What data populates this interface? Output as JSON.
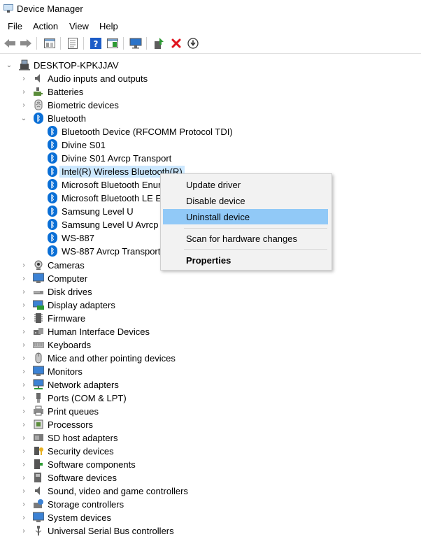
{
  "window": {
    "title": "Device Manager"
  },
  "menu": {
    "file": "File",
    "action": "Action",
    "view": "View",
    "help": "Help"
  },
  "toolbar": {
    "icons": [
      "back-arrow-icon",
      "forward-arrow-icon",
      "properties-grid-icon",
      "sheet-icon",
      "help-icon",
      "panel-icon",
      "monitor-icon",
      "update-driver-icon",
      "uninstall-x-icon",
      "download-circle-icon"
    ],
    "colors": {
      "help": "#1c5cc7",
      "uninstall": "#e0141e",
      "update": "#2e9a34"
    }
  },
  "tree": {
    "root": "DESKTOP-KPKJJAV",
    "categories_before": [
      {
        "label": "Audio inputs and outputs",
        "icon": "speaker-icon"
      },
      {
        "label": "Batteries",
        "icon": "battery-icon"
      },
      {
        "label": "Biometric devices",
        "icon": "fingerprint-icon"
      }
    ],
    "bluetooth": {
      "label": "Bluetooth",
      "children": [
        "Bluetooth Device (RFCOMM Protocol TDI)",
        "Divine S01",
        "Divine S01 Avrcp Transport",
        "Intel(R) Wireless Bluetooth(R)",
        "Microsoft Bluetooth Enum",
        "Microsoft Bluetooth LE En",
        "Samsung Level U",
        "Samsung Level U Avrcp Tr",
        "WS-887",
        "WS-887 Avrcp Transport"
      ],
      "selected_index": 3
    },
    "categories_after": [
      {
        "label": "Cameras",
        "icon": "camera-icon"
      },
      {
        "label": "Computer",
        "icon": "computer-icon"
      },
      {
        "label": "Disk drives",
        "icon": "disk-drive-icon"
      },
      {
        "label": "Display adapters",
        "icon": "display-adapter-icon"
      },
      {
        "label": "Firmware",
        "icon": "firmware-chip-icon"
      },
      {
        "label": "Human Interface Devices",
        "icon": "hid-icon"
      },
      {
        "label": "Keyboards",
        "icon": "keyboard-icon"
      },
      {
        "label": "Mice and other pointing devices",
        "icon": "mouse-icon"
      },
      {
        "label": "Monitors",
        "icon": "monitor-icon"
      },
      {
        "label": "Network adapters",
        "icon": "network-adapter-icon"
      },
      {
        "label": "Ports (COM & LPT)",
        "icon": "port-icon"
      },
      {
        "label": "Print queues",
        "icon": "printer-icon"
      },
      {
        "label": "Processors",
        "icon": "processor-icon"
      },
      {
        "label": "SD host adapters",
        "icon": "sd-card-icon"
      },
      {
        "label": "Security devices",
        "icon": "security-key-icon"
      },
      {
        "label": "Software components",
        "icon": "software-component-icon"
      },
      {
        "label": "Software devices",
        "icon": "software-device-icon"
      },
      {
        "label": "Sound, video and game controllers",
        "icon": "sound-icon"
      },
      {
        "label": "Storage controllers",
        "icon": "storage-controller-icon"
      },
      {
        "label": "System devices",
        "icon": "system-device-icon"
      },
      {
        "label": "Universal Serial Bus controllers",
        "icon": "usb-icon"
      }
    ]
  },
  "context_menu": {
    "update_driver": "Update driver",
    "disable_device": "Disable device",
    "uninstall_device": "Uninstall device",
    "scan_hardware": "Scan for hardware changes",
    "properties": "Properties",
    "hover_color": "#91c9f7"
  }
}
